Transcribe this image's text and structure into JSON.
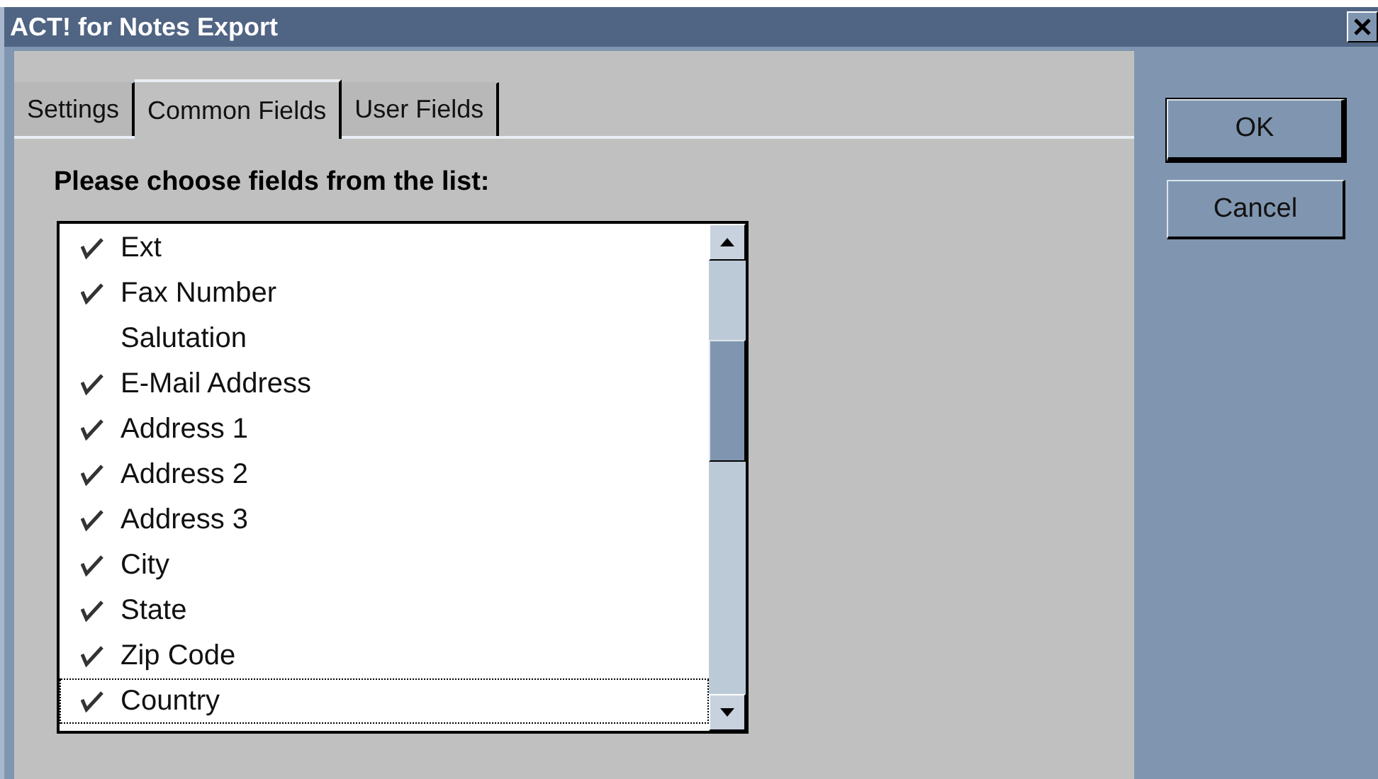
{
  "window": {
    "title": "ACT! for Notes Export"
  },
  "tabs": [
    {
      "label": "Settings",
      "selected": false
    },
    {
      "label": "Common Fields",
      "selected": true
    },
    {
      "label": "User Fields",
      "selected": false
    }
  ],
  "prompt": "Please choose fields from the list:",
  "fields": [
    {
      "label": "Ext",
      "checked": true,
      "focused": false
    },
    {
      "label": "Fax Number",
      "checked": true,
      "focused": false
    },
    {
      "label": "Salutation",
      "checked": false,
      "focused": false
    },
    {
      "label": "E-Mail Address",
      "checked": true,
      "focused": false
    },
    {
      "label": "Address 1",
      "checked": true,
      "focused": false
    },
    {
      "label": "Address 2",
      "checked": true,
      "focused": false
    },
    {
      "label": "Address 3",
      "checked": true,
      "focused": false
    },
    {
      "label": "City",
      "checked": true,
      "focused": false
    },
    {
      "label": "State",
      "checked": true,
      "focused": false
    },
    {
      "label": "Zip Code",
      "checked": true,
      "focused": false
    },
    {
      "label": "Country",
      "checked": true,
      "focused": true
    }
  ],
  "buttons": [
    {
      "label": "OK",
      "default": true
    },
    {
      "label": "Cancel",
      "default": false
    }
  ]
}
